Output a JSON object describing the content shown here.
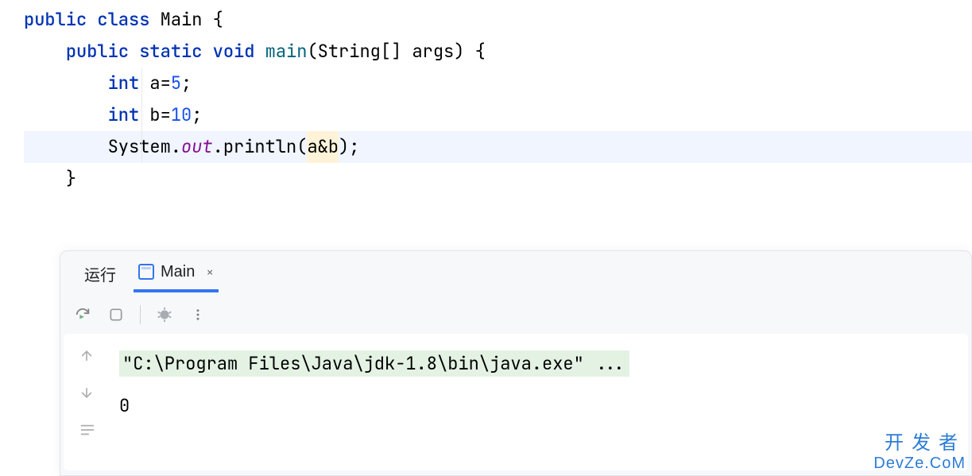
{
  "code": {
    "line1": {
      "kw_public": "public",
      "kw_class": "class",
      "class_name": "Main",
      "brace": "{"
    },
    "line2": {
      "kw_public": "public",
      "kw_static": "static",
      "kw_void": "void",
      "method": "main",
      "params": "(String[] args) {"
    },
    "line3": {
      "kw_int": "int",
      "rest": " a=",
      "num": "5",
      "semi": ";"
    },
    "line4": {
      "kw_int": "int",
      "rest": " b=",
      "num": "10",
      "semi": ";"
    },
    "line5": {
      "cls": "System.",
      "field": "out",
      "call": ".println(",
      "args": "a&b",
      "end": ");"
    },
    "line6": {
      "brace": "}"
    }
  },
  "panel": {
    "run_label": "运行",
    "tab_name": "Main",
    "close": "×"
  },
  "output": {
    "line1": "\"C:\\Program Files\\Java\\jdk-1.8\\bin\\java.exe\" ...",
    "line2": "0"
  },
  "watermark": {
    "cn": "开发者",
    "en": "DevZe.CoM"
  }
}
